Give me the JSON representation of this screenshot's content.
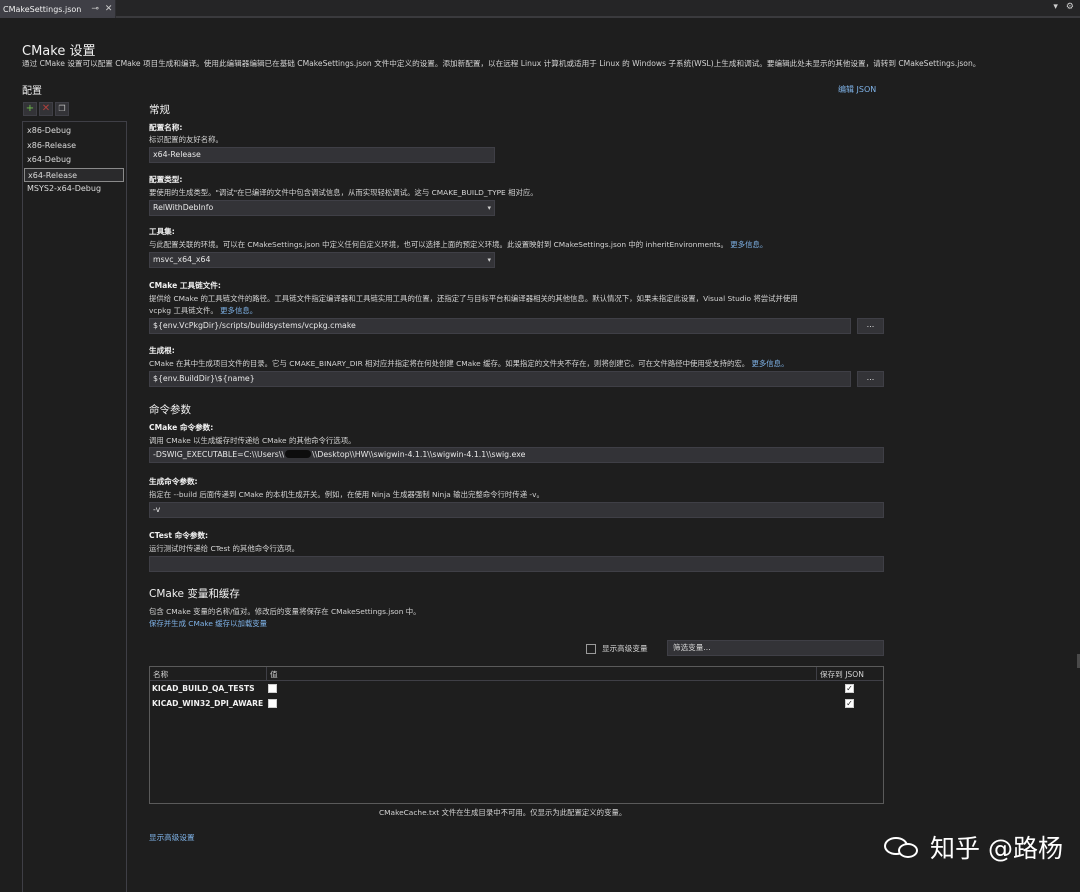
{
  "tab": {
    "title": "CMakeSettings.json",
    "pin_icon": "pin-icon",
    "close_icon": "close-icon"
  },
  "page": {
    "title": "CMake 设置",
    "description": "通过 CMake 设置可以配置 CMake 项目生成和编译。使用此编辑器编辑已在基础 CMakeSettings.json 文件中定义的设置。添加新配置，以在远程 Linux 计算机或适用于 Linux 的 Windows 子系统(WSL)上生成和调试。要编辑此处未显示的其他设置，请转到 CMakeSettings.json。",
    "edit_json": "编辑 JSON"
  },
  "configs": {
    "label": "配置",
    "items": [
      "x86-Debug",
      "x86-Release",
      "x64-Debug",
      "x64-Release",
      "MSYS2-x64-Debug"
    ],
    "selected": "x64-Release"
  },
  "general": {
    "heading": "常规",
    "name_label": "配置名称:",
    "name_help": "标识配置的友好名称。",
    "name_value": "x64-Release",
    "type_label": "配置类型:",
    "type_help": "要使用的生成类型。\"调试\"在已编译的文件中包含调试信息，从而实现轻松调试。这与 CMAKE_BUILD_TYPE 相对应。",
    "type_value": "RelWithDebInfo",
    "toolset_label": "工具集:",
    "toolset_help": "与此配置关联的环境。可以在 CMakeSettings.json 中定义任何自定义环境，也可以选择上面的预定义环境。此设置映射到 CMakeSettings.json 中的 inheritEnvironments。",
    "more_info": "更多信息。",
    "toolset_value": "msvc_x64_x64",
    "toolchain_label": "CMake 工具链文件:",
    "toolchain_help_1": "提供给 CMake 的工具链文件的路径。工具链文件指定编译器和工具链实用工具的位置，还指定了与目标平台和编译器相关的其他信息。默认情况下，如果未指定此设置，Visual Studio 将尝试并使用",
    "toolchain_help_2": "vcpkg 工具链文件。",
    "toolchain_value": "${env.VcPkgDir}/scripts/buildsystems/vcpkg.cmake",
    "browse": "...",
    "buildroot_label": "生成根:",
    "buildroot_help": "CMake 在其中生成项目文件的目录。它与 CMAKE_BINARY_DIR 相对应并指定将在何处创建 CMake 缓存。如果指定的文件夹不存在，则将创建它。可在文件路径中使用受支持的宏。",
    "buildroot_value": "${env.BuildDir}\\${name}"
  },
  "commands": {
    "heading": "命令参数",
    "cmake_label": "CMake 命令参数:",
    "cmake_help": "调用 CMake 以生成缓存时传递给 CMake 的其他命令行选项。",
    "cmake_value_prefix": "-DSWIG_EXECUTABLE=C:\\\\Users\\\\",
    "cmake_value_suffix": "\\\\Desktop\\\\HW\\\\swigwin-4.1.1\\\\swigwin-4.1.1\\\\swig.exe",
    "build_label": "生成命令参数:",
    "build_help": "指定在 --build 后面传递到 CMake 的本机生成开关。例如，在使用 Ninja 生成器强制 Ninja 输出完整命令行时传递 -v。",
    "build_value": "-v",
    "ctest_label": "CTest 命令参数:",
    "ctest_help": "运行测试时传递给 CTest 的其他命令行选项。",
    "ctest_value": ""
  },
  "variables": {
    "heading": "CMake 变量和缓存",
    "help": "包含 CMake 变量的名称/值对。修改后的变量将保存在 CMakeSettings.json 中。",
    "save_link": "保存并生成 CMake 缓存以加载变量",
    "show_advanced": "显示高级变量",
    "filter_placeholder": "筛选变量...",
    "columns": {
      "name": "名称",
      "value": "值",
      "save": "保存到 JSON"
    },
    "rows": [
      {
        "name": "KICAD_BUILD_QA_TESTS",
        "value": false,
        "save": true
      },
      {
        "name": "KICAD_WIN32_DPI_AWARE",
        "value": false,
        "save": true
      }
    ],
    "cache_note": "CMakeCache.txt 文件在生成目录中不可用。仅显示为此配置定义的变量。"
  },
  "footer": {
    "show_advanced_settings": "显示高级设置"
  },
  "watermark": {
    "text": "知乎 @路杨",
    "logo_icon": "zhihu-logo-icon"
  },
  "colors": {
    "background": "#1e1e1e",
    "field": "#333337",
    "link": "#7fb3e8",
    "add_icon": "#6fbf4b",
    "delete_icon": "#b0403c"
  }
}
